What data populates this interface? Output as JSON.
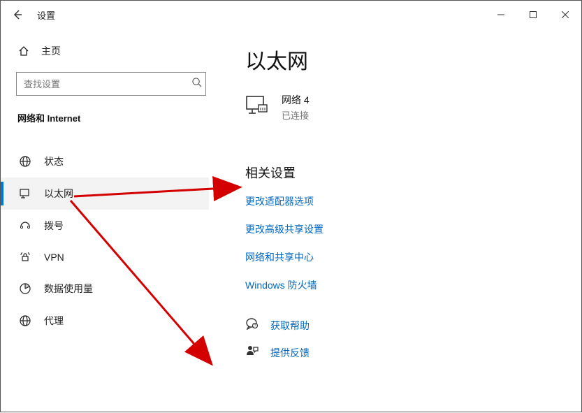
{
  "window": {
    "title": "设置",
    "home_label": "主页",
    "search_placeholder": "查找设置",
    "section_header": "网络和 Internet"
  },
  "sidebar": {
    "items": [
      {
        "id": "status",
        "label": "状态"
      },
      {
        "id": "ethernet",
        "label": "以太网",
        "selected": true
      },
      {
        "id": "dialup",
        "label": "拨号"
      },
      {
        "id": "vpn",
        "label": "VPN"
      },
      {
        "id": "data",
        "label": "数据使用量"
      },
      {
        "id": "proxy",
        "label": "代理"
      }
    ]
  },
  "main": {
    "title": "以太网",
    "network": {
      "name": "网络 4",
      "state": "已连接"
    },
    "related_header": "相关设置",
    "related_links": [
      "更改适配器选项",
      "更改高级共享设置",
      "网络和共享中心",
      "Windows 防火墙"
    ],
    "help_link": "获取帮助",
    "feedback_link": "提供反馈"
  }
}
